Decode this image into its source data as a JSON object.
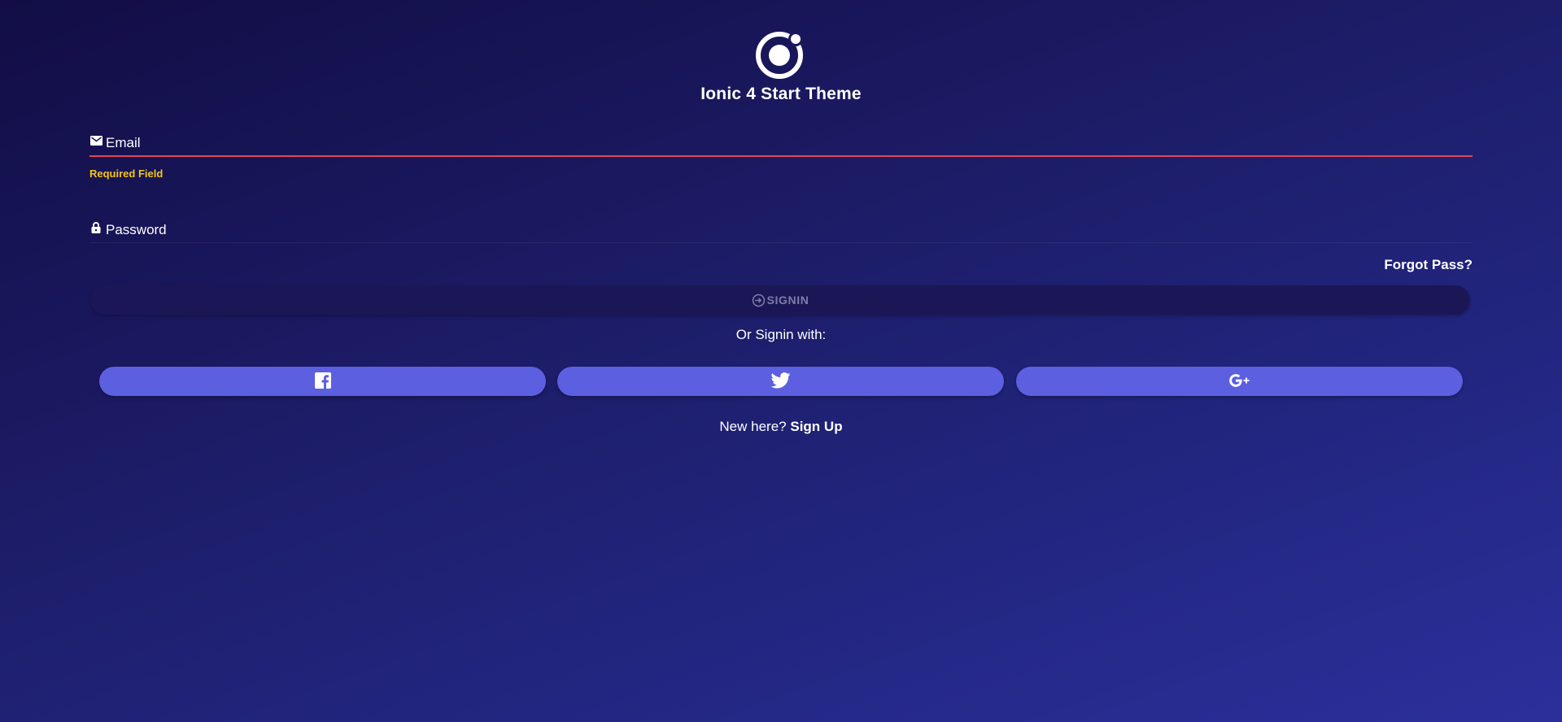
{
  "app": {
    "title": "Ionic 4 Start Theme",
    "logo_icon": "ionic-logo-icon"
  },
  "login_form": {
    "email": {
      "icon": "mail-icon",
      "placeholder": "Email",
      "value": "",
      "error": "Required Field"
    },
    "password": {
      "icon": "lock-icon",
      "placeholder": "Password",
      "value": ""
    },
    "forgot_label": "Forgot Pass?",
    "signin": {
      "icon": "log-in-icon",
      "label": "SIGNIN",
      "disabled": true
    }
  },
  "social": {
    "prompt": "Or Signin with:",
    "buttons": [
      {
        "icon": "facebook-icon"
      },
      {
        "icon": "twitter-icon"
      },
      {
        "icon": "google-plus-icon"
      }
    ]
  },
  "signup": {
    "prompt": "New here?",
    "link_label": "Sign Up"
  },
  "colors": {
    "background_start": "#120d45",
    "background_end": "#2c2f9b",
    "error_underline": "#e64553",
    "error_text": "#f5c518",
    "social_button": "#5b5fe0",
    "signin_disabled": "#1b1756"
  }
}
